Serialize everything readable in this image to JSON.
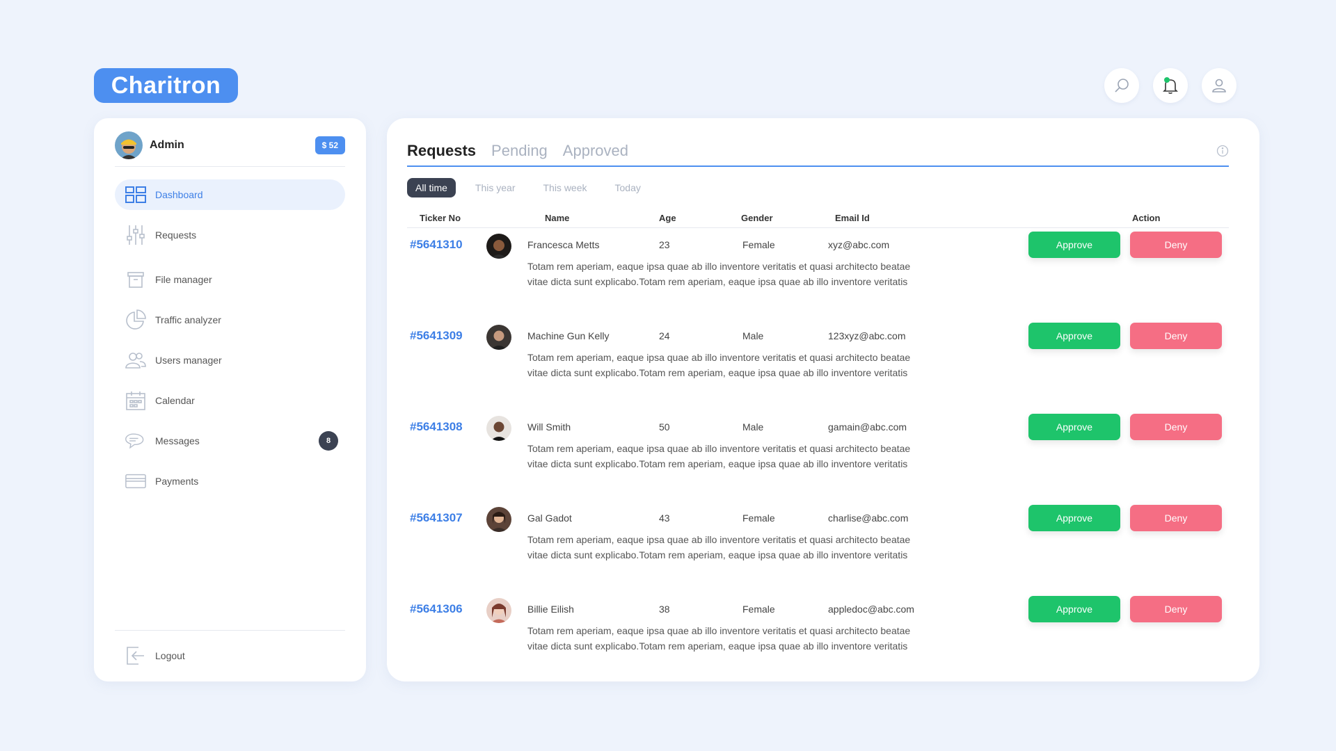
{
  "brand": {
    "name": "Charitron"
  },
  "top_icons": [
    "search-icon",
    "bell-icon",
    "user-icon"
  ],
  "profile": {
    "name": "Admin",
    "balance": "$ 52"
  },
  "sidebar": {
    "items": [
      {
        "label": "Dashboard",
        "icon": "dashboard-icon",
        "active": true
      },
      {
        "label": "Requests",
        "icon": "sliders-icon"
      },
      {
        "label": "File manager",
        "icon": "archive-icon"
      },
      {
        "label": "Traffic analyzer",
        "icon": "pie-chart-icon"
      },
      {
        "label": "Users manager",
        "icon": "users-icon"
      },
      {
        "label": "Calendar",
        "icon": "calendar-icon"
      },
      {
        "label": "Messages",
        "icon": "chat-icon",
        "badge": "8"
      },
      {
        "label": "Payments",
        "icon": "card-icon"
      }
    ],
    "logout": "Logout"
  },
  "main": {
    "tabs": [
      "Requests",
      "Pending",
      "Approved"
    ],
    "filters": [
      "All time",
      "This year",
      "This week",
      "Today"
    ],
    "columns": {
      "ticket": "Ticker No",
      "name": "Name",
      "age": "Age",
      "gender": "Gender",
      "email": "Email Id",
      "action": "Action"
    },
    "approve_label": "Approve",
    "deny_label": "Deny",
    "rows": [
      {
        "ticket": "#5641310",
        "name": "Francesca Metts",
        "age": "23",
        "gender": "Female",
        "email": "xyz@abc.com",
        "desc": "Totam rem aperiam, eaque ipsa quae ab illo inventore veritatis et quasi architecto beatae vitae dicta sunt explicabo.Totam rem aperiam, eaque ipsa quae ab illo inventore veritatis"
      },
      {
        "ticket": "#5641309",
        "name": "Machine Gun Kelly",
        "age": "24",
        "gender": "Male",
        "email": "123xyz@abc.com",
        "desc": "Totam rem aperiam, eaque ipsa quae ab illo inventore veritatis et quasi architecto beatae vitae dicta sunt explicabo.Totam rem aperiam, eaque ipsa quae ab illo inventore veritatis"
      },
      {
        "ticket": "#5641308",
        "name": "Will Smith",
        "age": "50",
        "gender": "Male",
        "email": "gamain@abc.com",
        "desc": "Totam rem aperiam, eaque ipsa quae ab illo inventore veritatis et quasi architecto beatae vitae dicta sunt explicabo.Totam rem aperiam, eaque ipsa quae ab illo inventore veritatis"
      },
      {
        "ticket": "#5641307",
        "name": "Gal Gadot",
        "age": "43",
        "gender": "Female",
        "email": "charlise@abc.com",
        "desc": "Totam rem aperiam, eaque ipsa quae ab illo inventore veritatis et quasi architecto beatae vitae dicta sunt explicabo.Totam rem aperiam, eaque ipsa quae ab illo inventore veritatis"
      },
      {
        "ticket": "#5641306",
        "name": "Billie Eilish",
        "age": "38",
        "gender": "Female",
        "email": "appledoc@abc.com",
        "desc": "Totam rem aperiam, eaque ipsa quae ab illo inventore veritatis et quasi architecto beatae vitae dicta sunt explicabo.Totam rem aperiam, eaque ipsa quae ab illo inventore veritatis"
      }
    ]
  },
  "colors": {
    "accent": "#4d8ff0",
    "approve": "#1ec46b",
    "deny": "#f56e84",
    "dark": "#3b4252",
    "background": "#eef3fc"
  }
}
